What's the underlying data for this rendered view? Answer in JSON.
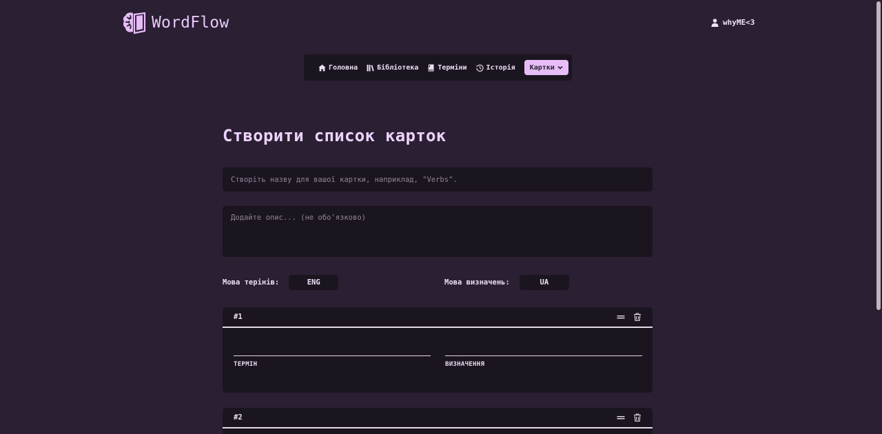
{
  "app": {
    "name": "WordFlow"
  },
  "user": {
    "name": "whyME<3"
  },
  "nav": {
    "items": [
      {
        "label": "Головна",
        "icon": "home-icon"
      },
      {
        "label": "Бібліотека",
        "icon": "library-icon"
      },
      {
        "label": "Терміни",
        "icon": "bookmark-icon"
      },
      {
        "label": "Історія",
        "icon": "history-icon"
      }
    ],
    "active": {
      "label": "Картки",
      "icon": "chevron-down-icon"
    }
  },
  "main": {
    "title": "Створити список карток",
    "name_input": {
      "value": "",
      "placeholder": "Створіть назву для вашої картки, наприклад, \"Verbs\"."
    },
    "description_input": {
      "value": "",
      "placeholder": "Додайте опис... (не обо'язково)"
    },
    "term_language": {
      "label": "Мова терінів:",
      "value": "ENG"
    },
    "definition_language": {
      "label": "Мова визначень:",
      "value": "UA"
    }
  },
  "cards": [
    {
      "number": "#1",
      "term_label": "ТЕРМІН",
      "definition_label": "ВИЗНАЧЕННЯ",
      "term_value": "",
      "definition_value": ""
    },
    {
      "number": "#2"
    }
  ],
  "colors": {
    "background": "#2a1f33",
    "surface": "#1b1520",
    "accent": "#e6bdf6",
    "text": "#eadff1"
  }
}
